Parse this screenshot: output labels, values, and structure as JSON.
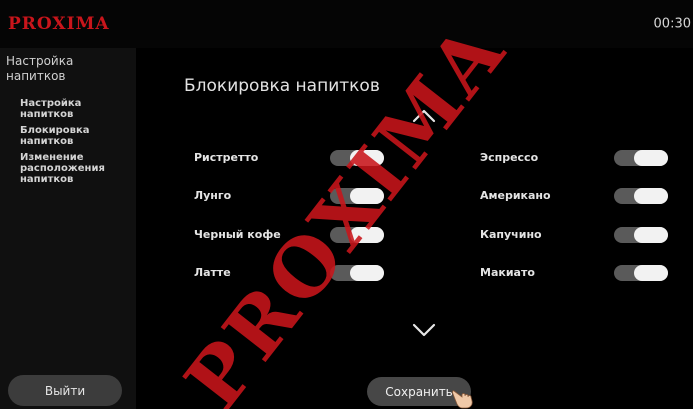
{
  "header": {
    "logo": "PROXIMA",
    "clock": "00:30"
  },
  "sidebar": {
    "title": "Настройка напитков",
    "items": [
      {
        "label": "Настройка напитков"
      },
      {
        "label": "Блокировка напитков"
      },
      {
        "label": "Изменение расположения напитков"
      }
    ],
    "exit_label": "Выйти"
  },
  "main": {
    "title": "Блокировка напитков",
    "left_column": [
      {
        "label": "Ристретто",
        "enabled": true
      },
      {
        "label": "Лунго",
        "enabled": true
      },
      {
        "label": "Черный кофе",
        "enabled": true
      },
      {
        "label": "Латте",
        "enabled": true
      }
    ],
    "right_column": [
      {
        "label": "Эспрессо",
        "enabled": true
      },
      {
        "label": "Американо",
        "enabled": true
      },
      {
        "label": "Капучино",
        "enabled": true
      },
      {
        "label": "Макиато",
        "enabled": true
      }
    ],
    "save_label": "Сохранить",
    "scroll_up_icon": "chevron-up-icon",
    "scroll_down_icon": "chevron-down-icon"
  },
  "watermark": "PROXIMA",
  "colors": {
    "brand": "#c9151b",
    "toggle_track": "#5a5a5a",
    "toggle_knob": "#f2f2f2",
    "button": "#474747"
  }
}
